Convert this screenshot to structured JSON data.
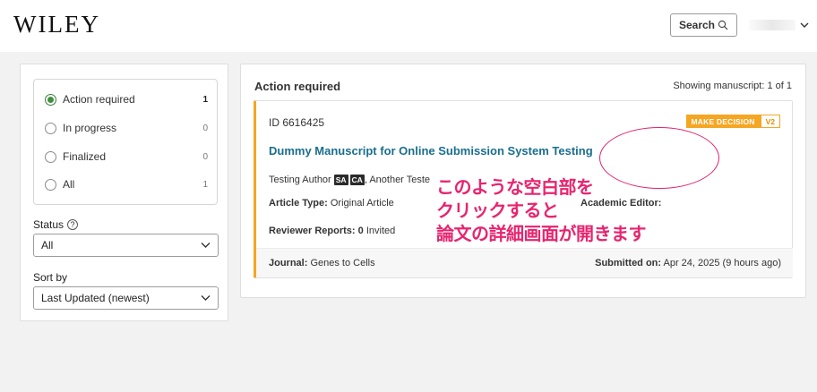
{
  "header": {
    "logo": "WILEY",
    "search_label": "Search",
    "user_name_hidden": ""
  },
  "sidebar": {
    "filters": [
      {
        "label": "Action required",
        "count": "1",
        "checked": true
      },
      {
        "label": "In progress",
        "count": "0",
        "checked": false
      },
      {
        "label": "Finalized",
        "count": "0",
        "checked": false
      },
      {
        "label": "All",
        "count": "1",
        "checked": false
      }
    ],
    "status_label": "Status",
    "status_help": "?",
    "status_value": "All",
    "sort_label": "Sort by",
    "sort_value": "Last Updated (newest)"
  },
  "main": {
    "title": "Action required",
    "showing": "Showing manuscript: 1 of 1",
    "card": {
      "id": "ID 6616425",
      "badge_decision": "MAKE DECISION",
      "badge_version": "V2",
      "title": "Dummy Manuscript for Online Submission System Testing",
      "author1": "Testing Author",
      "role1": "SA",
      "role2": "CA",
      "author2": ", Another Teste",
      "article_type_label": "Article Type:",
      "article_type_value": " Original Article",
      "academic_editor_label": "Academic Editor:",
      "reviewer_label": "Reviewer Reports:",
      "reviewer_count": " 0",
      "reviewer_status": " Invited",
      "journal_label": "Journal:",
      "journal_value": " Genes to Cells",
      "submitted_label": "Submitted on:",
      "submitted_value": " Apr 24, 2025 (9 hours ago)"
    }
  },
  "annotation": {
    "line1": "このような空白部を",
    "line2": "クリックすると",
    "line3": "論文の詳細画面が開きます",
    "color": "#e8246f"
  }
}
